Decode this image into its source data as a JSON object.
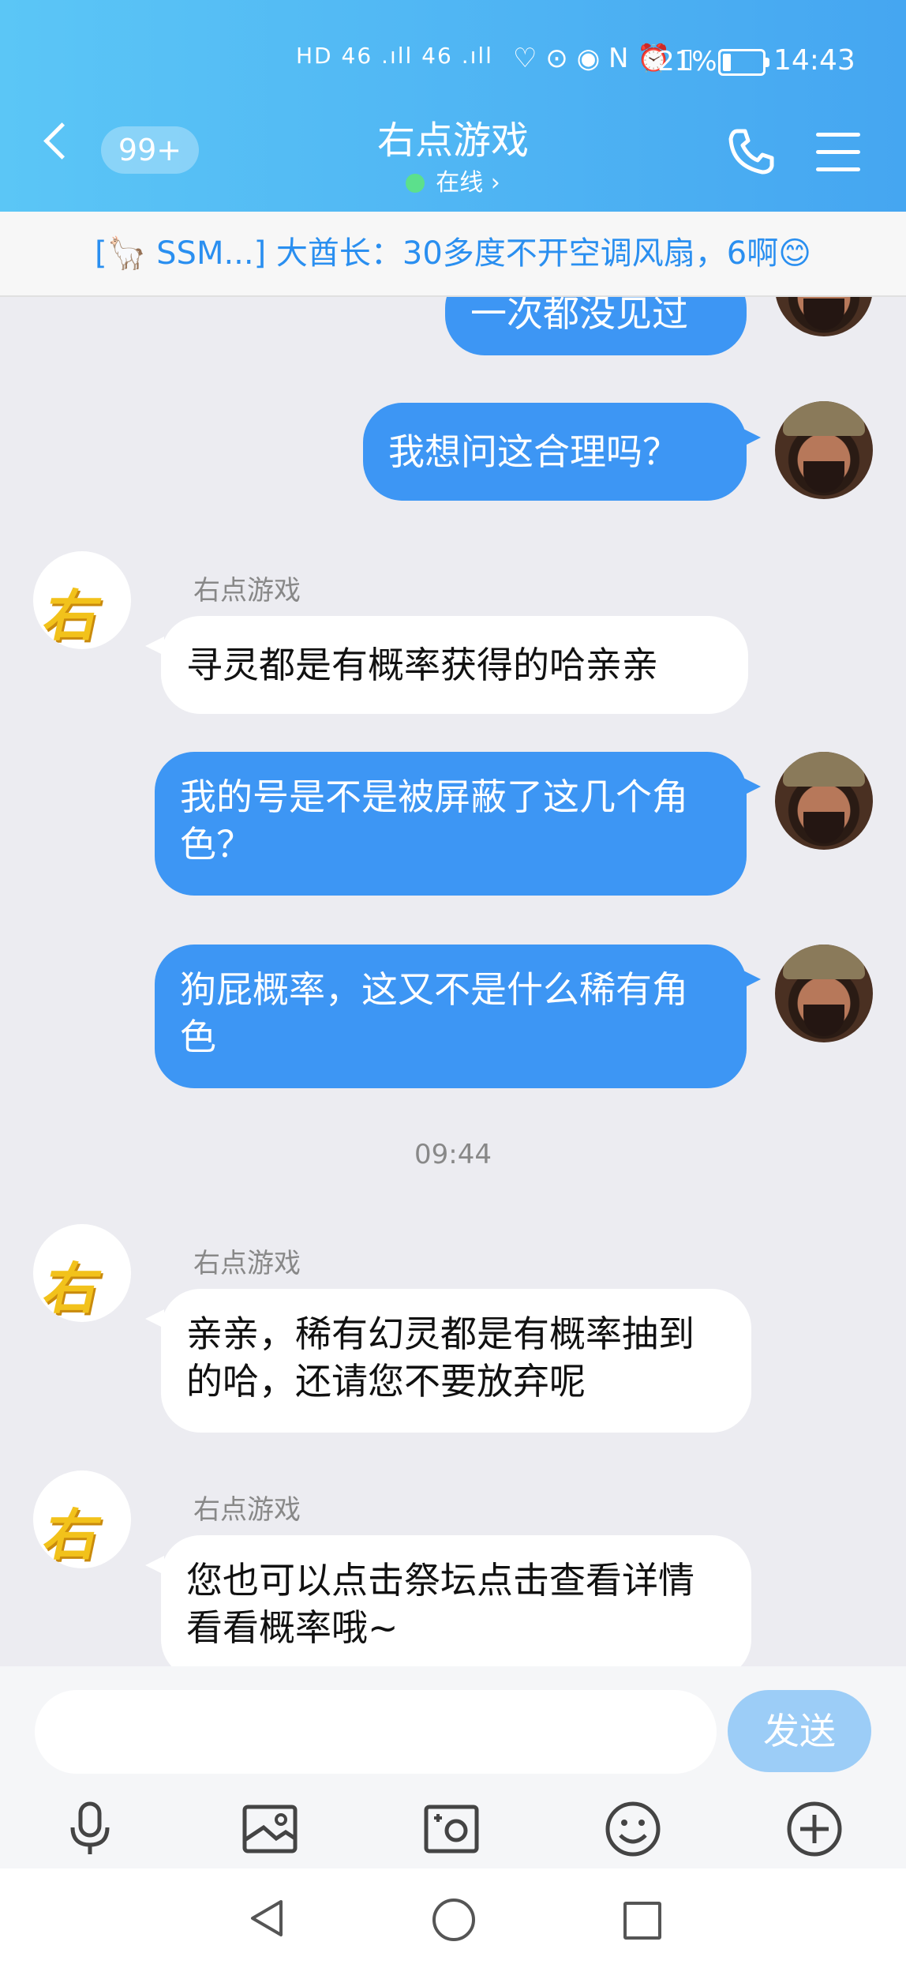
{
  "status_bar": {
    "signal": "HD 46 .ıll 46 .ıll",
    "icons": "♡ ⊙ ◉ N ⏰ ▯",
    "battery_percent": "21%",
    "battery_level": 0.21,
    "time": "14:43"
  },
  "header": {
    "back_icon": "chevron-left-icon",
    "unread_badge": "99+",
    "title": "右点游戏",
    "status": "在线 ›",
    "call_icon": "phone-icon",
    "menu_icon": "hamburger-menu-icon"
  },
  "announcement": "[🦙 SSM...] 大酋长：30多度不开空调风扇，6啊😊",
  "messages": [
    {
      "from": "me",
      "text": "一次都没见过"
    },
    {
      "from": "me",
      "text": "我想问这合理吗？"
    },
    {
      "from": "them",
      "sender": "右点游戏",
      "text": "寻灵都是有概率获得的哈亲亲"
    },
    {
      "from": "me",
      "text": "我的号是不是被屏蔽了这几个角色？"
    },
    {
      "from": "me",
      "text": "狗屁概率，这又不是什么稀有角色"
    },
    {
      "from": "them",
      "sender": "右点游戏",
      "text": "亲亲，稀有幻灵都是有概率抽到的哈，还请您不要放弃呢"
    },
    {
      "from": "them",
      "sender": "右点游戏",
      "text": "您也可以点击祭坛点击查看详情看看概率哦~"
    }
  ],
  "timestamp": "09:44",
  "avatar_logo_text": "右",
  "composer": {
    "placeholder": "",
    "send_label": "发送"
  },
  "toolbar": [
    "microphone-icon",
    "image-icon",
    "camera-icon",
    "emoji-icon",
    "plus-icon"
  ],
  "nav": [
    "back-triangle-icon",
    "home-circle-icon",
    "recent-square-icon"
  ],
  "colors": {
    "header_start": "#5bc6f6",
    "header_end": "#45a6f1",
    "my_bubble": "#3d96f4",
    "their_bubble": "#ffffff",
    "send_button": "#9ccdf7",
    "announcement_text": "#2a8ff0",
    "chat_background": "#ececf1"
  }
}
